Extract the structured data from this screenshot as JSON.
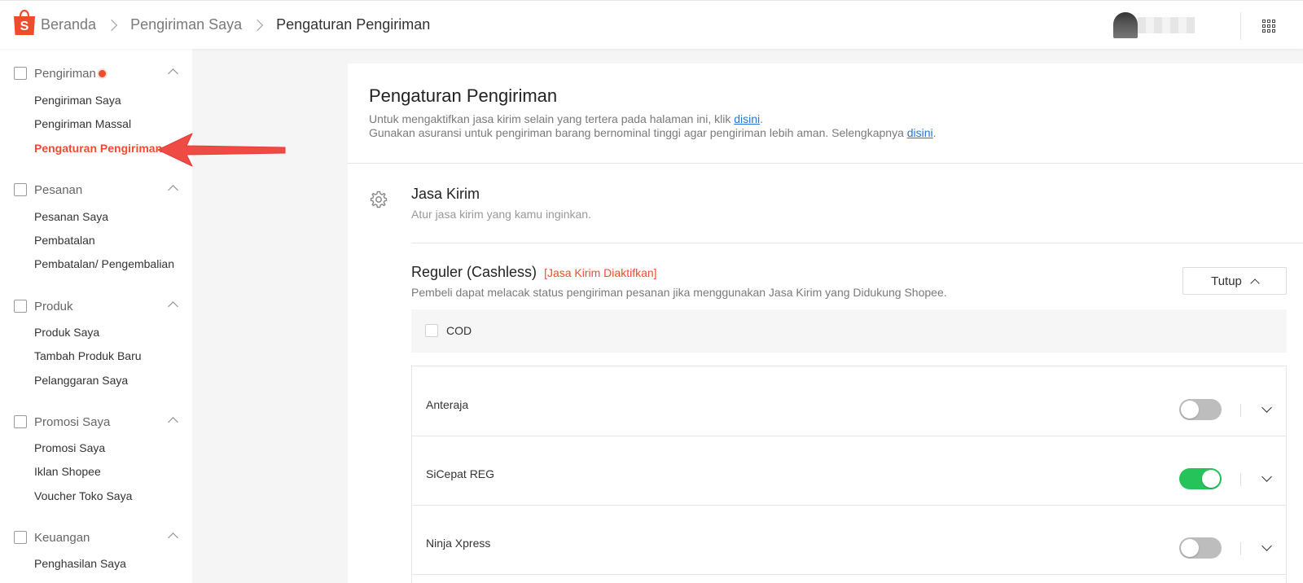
{
  "header": {
    "breadcrumbs": [
      "Beranda",
      "Pengiriman Saya",
      "Pengaturan Pengiriman"
    ]
  },
  "sidebar": {
    "sections": [
      {
        "title": "Pengiriman",
        "icon": "package-icon",
        "items": [
          "Pengiriman Saya",
          "Pengiriman Massal",
          "Pengaturan Pengiriman"
        ]
      },
      {
        "title": "Pesanan",
        "icon": "clipboard-icon",
        "items": [
          "Pesanan Saya",
          "Pembatalan",
          "Pembatalan/ Pengembalian"
        ]
      },
      {
        "title": "Produk",
        "icon": "box-icon",
        "items": [
          "Produk Saya",
          "Tambah Produk Baru",
          "Pelanggaran Saya"
        ]
      },
      {
        "title": "Promosi Saya",
        "icon": "tag-icon",
        "items": [
          "Promosi Saya",
          "Iklan Shopee",
          "Voucher Toko Saya"
        ]
      },
      {
        "title": "Keuangan",
        "icon": "wallet-icon",
        "items": [
          "Penghasilan Saya"
        ]
      }
    ],
    "active_item": "Pengaturan Pengiriman"
  },
  "main": {
    "title": "Pengaturan Pengiriman",
    "info1_prefix": "Untuk mengaktifkan jasa kirim selain yang tertera pada halaman ini, klik ",
    "info1_link": "disini",
    "info1_suffix": ".",
    "info2_prefix": "Gunakan asuransi untuk pengiriman barang bernominal tinggi agar pengiriman lebih aman. Selengkapnya ",
    "info2_link": "disini",
    "info2_suffix": ".",
    "jasa_kirim": {
      "title": "Jasa Kirim",
      "subtitle": "Atur jasa kirim yang kamu inginkan."
    },
    "reguler": {
      "title": "Reguler (Cashless)",
      "badge": "[Jasa Kirim Diaktifkan]",
      "subtitle": "Pembeli dapat melacak status pengiriman pesanan jika menggunakan Jasa Kirim yang Didukung Shopee.",
      "close_label": "Tutup",
      "cod_label": "COD",
      "cod_checked": false
    },
    "couriers": [
      {
        "name": "Anteraja",
        "enabled": false
      },
      {
        "name": "SiCepat REG",
        "enabled": true
      },
      {
        "name": "Ninja Xpress",
        "enabled": false
      }
    ]
  },
  "colors": {
    "brand": "#ee4d2d",
    "toggle_on": "#26c35a",
    "link": "#2673dd"
  }
}
